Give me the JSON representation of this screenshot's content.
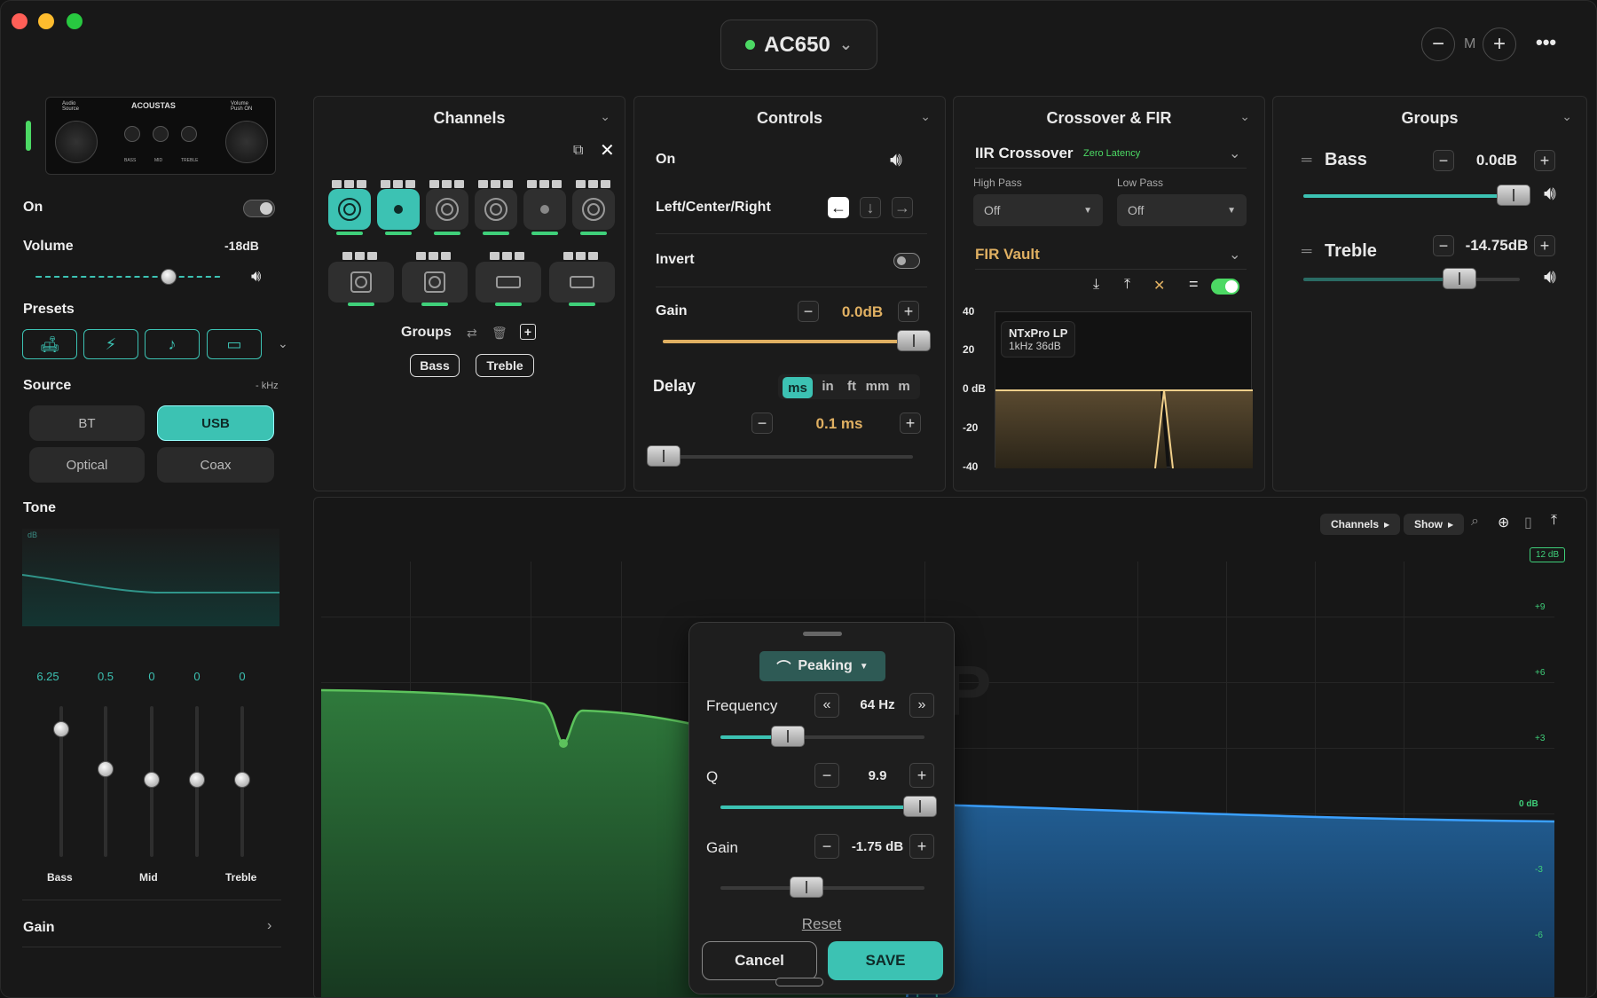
{
  "header": {
    "device": "AC650",
    "zoom_label": "M",
    "minus": "−",
    "plus": "+",
    "more": "•••"
  },
  "colors": {
    "accent": "#3cc2b3",
    "green": "#3fd07a",
    "gold": "#e0b062",
    "blue": "#2f7fd1"
  },
  "sidebar": {
    "on_label": "On",
    "volume_label": "Volume",
    "volume_value": "-18dB",
    "volume_fraction": 0.72,
    "presets_label": "Presets",
    "presets": [
      "sofa-icon",
      "bolt-icon",
      "guitar-icon",
      "car-icon"
    ],
    "source_label": "Source",
    "source_rate": "- kHz",
    "sources": [
      "BT",
      "USB",
      "Optical",
      "Coax"
    ],
    "selected_source": "USB",
    "tone_label": "Tone",
    "tone_db": "dB",
    "tone_values": [
      "6.25",
      "0.5",
      "0",
      "0",
      "0"
    ],
    "tone_bands": [
      "Bass",
      "Mid",
      "Treble"
    ],
    "gain_label": "Gain"
  },
  "device_image": {
    "brand": "ACOUSTAS",
    "audio_source": "Audio Source",
    "volume": "Volume Push ON",
    "knob_labels": [
      "BASS",
      "MID",
      "TREBLE"
    ]
  },
  "channels": {
    "title": "Channels",
    "groups_label": "Groups",
    "groups": [
      "Bass",
      "Treble"
    ]
  },
  "controls": {
    "title": "Controls",
    "on": "On",
    "lcr": "Left/Center/Right",
    "invert": "Invert",
    "gain_label": "Gain",
    "gain_value": "0.0dB",
    "delay_label": "Delay",
    "delay_units": [
      "ms",
      "in",
      "ft",
      "mm",
      "m"
    ],
    "delay_unit_selected": "ms",
    "delay_value": "0.1 ms"
  },
  "crossover": {
    "title": "Crossover & FIR",
    "iir_label": "IIR Crossover",
    "iir_badge": "Zero Latency",
    "high_pass_label": "High Pass",
    "high_pass_value": "Off",
    "low_pass_label": "Low Pass",
    "low_pass_value": "Off",
    "fir_label": "FIR Vault",
    "plot_y_ticks": [
      "40",
      "20",
      "0 dB",
      "-20",
      "-40"
    ],
    "fir_tooltip_title": "NTxPro LP",
    "fir_tooltip_detail": "1kHz 36dB"
  },
  "groups_panel": {
    "title": "Groups",
    "items": [
      {
        "name": "Bass",
        "value": "0.0dB",
        "fraction": 0.97
      },
      {
        "name": "Treble",
        "value": "-14.75dB",
        "fraction": 0.72
      }
    ]
  },
  "eq": {
    "toolbar": {
      "channels": "Channels",
      "show": "Show"
    },
    "db_badge": "12 dB",
    "y_ticks": [
      "+9",
      "+6",
      "+3",
      "0 dB",
      "-3",
      "-6"
    ],
    "watermark": "rDSP"
  },
  "popup": {
    "filter_type": "Peaking",
    "frequency_label": "Frequency",
    "frequency_value": "64 Hz",
    "frequency_fraction": 0.33,
    "q_label": "Q",
    "q_value": "9.9",
    "q_fraction": 0.98,
    "gain_label": "Gain",
    "gain_value": "-1.75 dB",
    "gain_fraction": 0.42,
    "reset": "Reset",
    "cancel": "Cancel",
    "save": "SAVE"
  }
}
